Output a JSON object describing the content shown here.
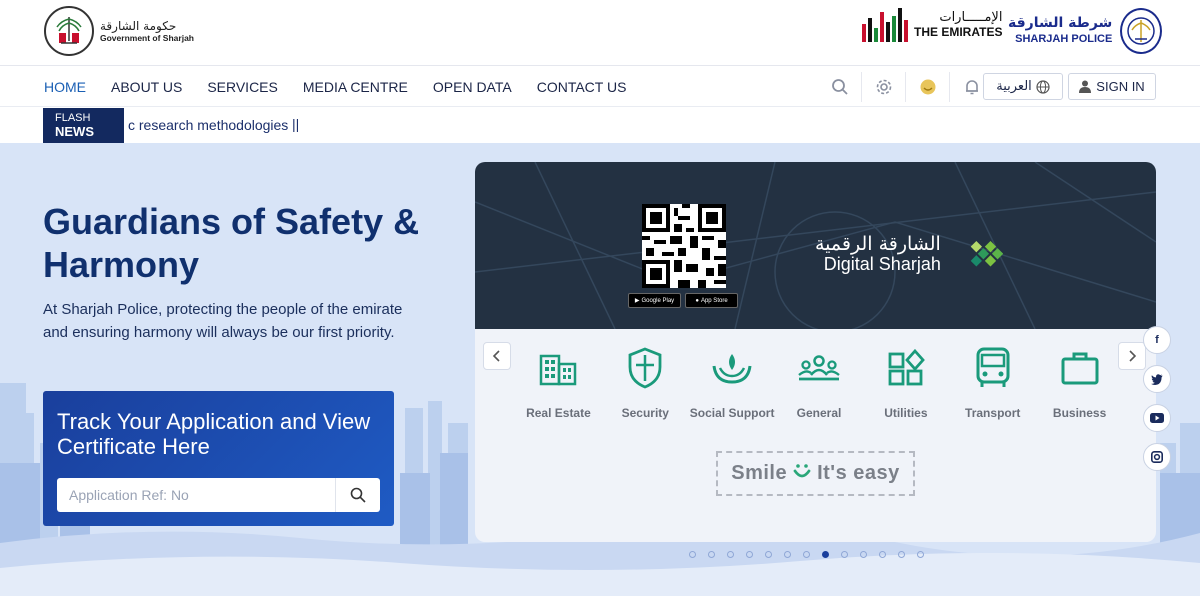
{
  "header": {
    "gov_logo_ar": "حكومة الشارقة",
    "gov_logo_en": "Government of Sharjah",
    "emirates_ar": "الإمـــــارات",
    "emirates_en": "THE EMIRATES",
    "police_ar": "شرطة الشارقة",
    "police_en": "SHARJAH POLICE"
  },
  "nav": {
    "links": [
      "HOME",
      "ABOUT US",
      "SERVICES",
      "MEDIA CENTRE",
      "OPEN DATA",
      "CONTACT US"
    ],
    "active": "HOME",
    "tools": [
      "search-icon",
      "gear-icon",
      "accessibility-icon",
      "bell-icon"
    ],
    "language_label": "العربية",
    "signin_label": "SIGN IN"
  },
  "flash": {
    "label_line1": "FLASH",
    "label_line2": "NEWS",
    "text": "c research methodologies",
    "pause": "||"
  },
  "hero": {
    "title": "Guardians of Safety & Harmony",
    "description": "At Sharjah Police, protecting the people of the emirate and ensuring harmony will always be our first priority."
  },
  "track": {
    "title": "Track Your Application and View Certificate Here",
    "placeholder": "Application Ref: No",
    "value": ""
  },
  "banner": {
    "digital_ar": "الشارقة الرقمية",
    "digital_en": "Digital Sharjah",
    "google_play": "Google Play",
    "app_store": "App Store"
  },
  "services": [
    "Real Estate",
    "Security",
    "Social Support",
    "General",
    "Utilities",
    "Transport",
    "Business"
  ],
  "smile": {
    "left": "Smile",
    "face": "◡̈",
    "right": "It's easy"
  },
  "carousel": {
    "total": 13,
    "active_index": 7
  },
  "social": [
    "f",
    "t",
    "▶",
    "◎"
  ],
  "colors": {
    "brand_navy": "#13295f",
    "brand_blue": "#1a5fb4",
    "service_green": "#1a9a7b",
    "hero_bg": "#d8e4f7"
  }
}
